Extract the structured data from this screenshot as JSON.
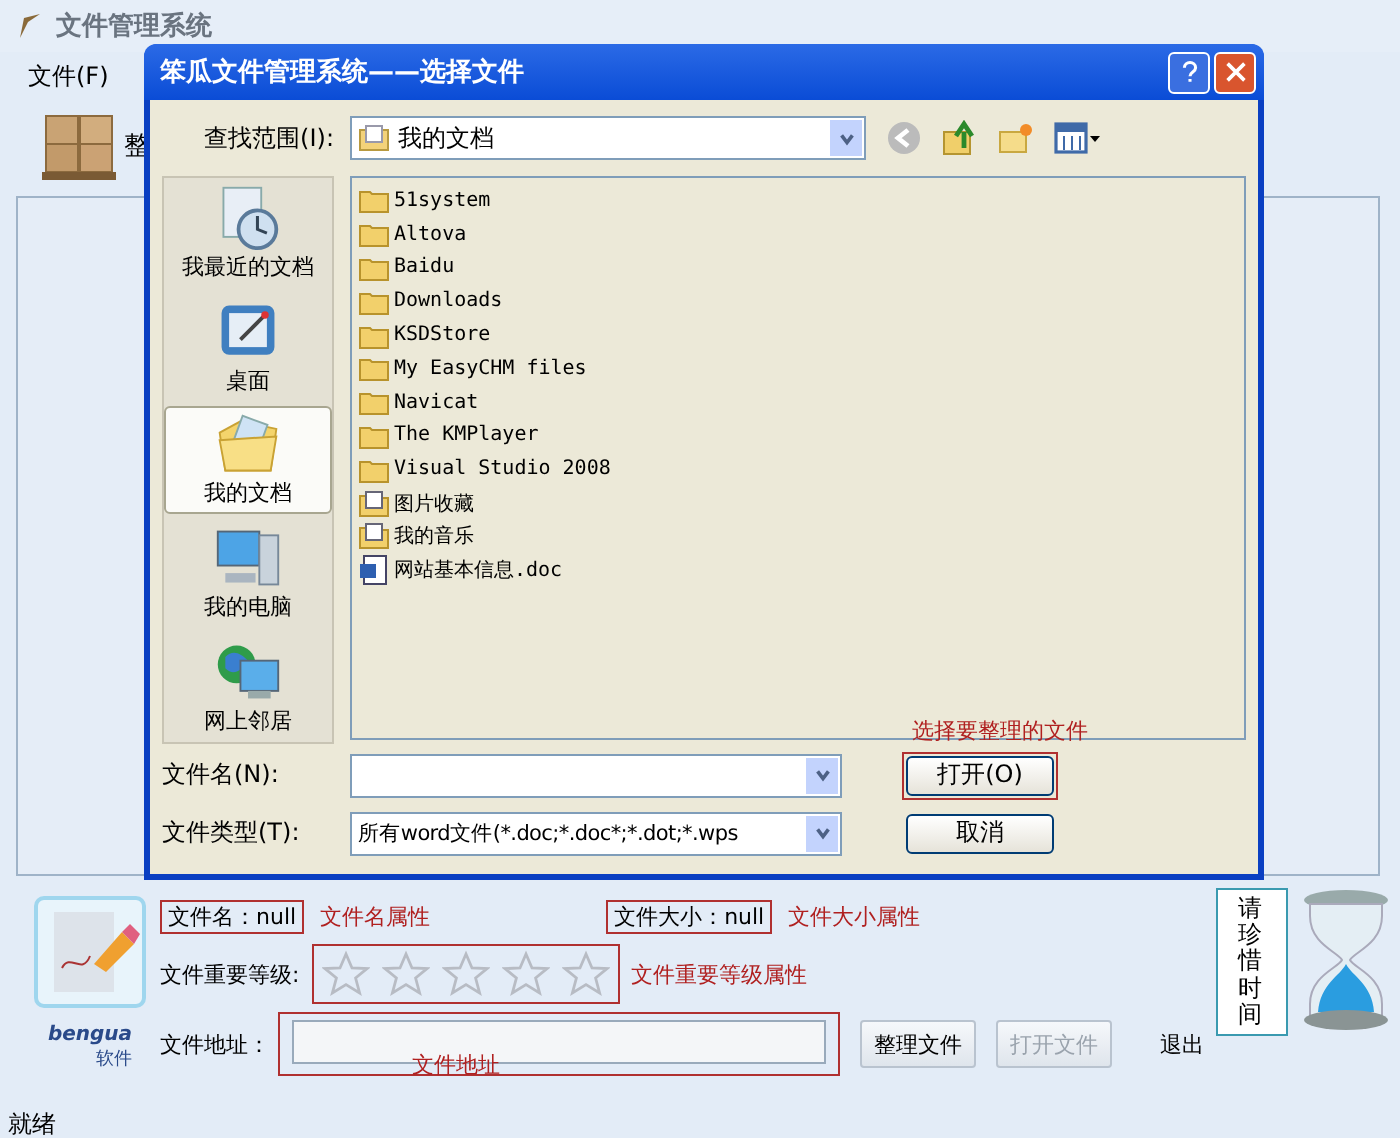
{
  "window": {
    "title": "文件管理系统"
  },
  "menu": [
    {
      "label": "文件(F)"
    }
  ],
  "toolbar": {
    "label": "整"
  },
  "dialog": {
    "title": "笨瓜文件管理系统——选择文件",
    "look_in_label": "查找范围(I):",
    "look_in_value": "我的文档",
    "places": [
      {
        "label": "我最近的文档",
        "kind": "recent",
        "selected": false
      },
      {
        "label": "桌面",
        "kind": "desktop",
        "selected": false
      },
      {
        "label": "我的文档",
        "kind": "documents",
        "selected": true
      },
      {
        "label": "我的电脑",
        "kind": "computer",
        "selected": false
      },
      {
        "label": "网上邻居",
        "kind": "network",
        "selected": false
      }
    ],
    "files": [
      {
        "name": "51system",
        "kind": "folder"
      },
      {
        "name": "Altova",
        "kind": "folder"
      },
      {
        "name": "Baidu",
        "kind": "folder"
      },
      {
        "name": "Downloads",
        "kind": "folder"
      },
      {
        "name": "KSDStore",
        "kind": "folder"
      },
      {
        "name": "My EasyCHM files",
        "kind": "folder"
      },
      {
        "name": "Navicat",
        "kind": "folder"
      },
      {
        "name": "The KMPlayer",
        "kind": "folder"
      },
      {
        "name": "Visual Studio 2008",
        "kind": "folder"
      },
      {
        "name": "图片收藏",
        "kind": "special"
      },
      {
        "name": "我的音乐",
        "kind": "special"
      },
      {
        "name": "网站基本信息.doc",
        "kind": "doc"
      }
    ],
    "filename_label": "文件名(N):",
    "filetype_label": "文件类型(T):",
    "filetype_value": "所有word文件(*.doc;*.doc*;*.dot;*.wps",
    "open_button": "打开(O)",
    "cancel_button": "取消",
    "open_note": "选择要整理的文件"
  },
  "details": {
    "logo_text": "bengua",
    "logo_sub": "软件",
    "file_name": "文件名：null",
    "file_name_note": "文件名属性",
    "file_size": "文件大小：null",
    "file_size_note": "文件大小属性",
    "importance_label": "文件重要等级:",
    "stars": 0,
    "importance_note": "文件重要等级属性",
    "address_label": "文件地址：",
    "address_note": "文件地址",
    "buttons": [
      {
        "label": "整理文件",
        "disabled": false,
        "kind": "raised"
      },
      {
        "label": "打开文件",
        "disabled": true,
        "kind": "raised"
      },
      {
        "label": "退出",
        "disabled": false,
        "kind": "flat"
      }
    ],
    "tip": "请珍惜时间"
  },
  "status_bar": "就绪"
}
